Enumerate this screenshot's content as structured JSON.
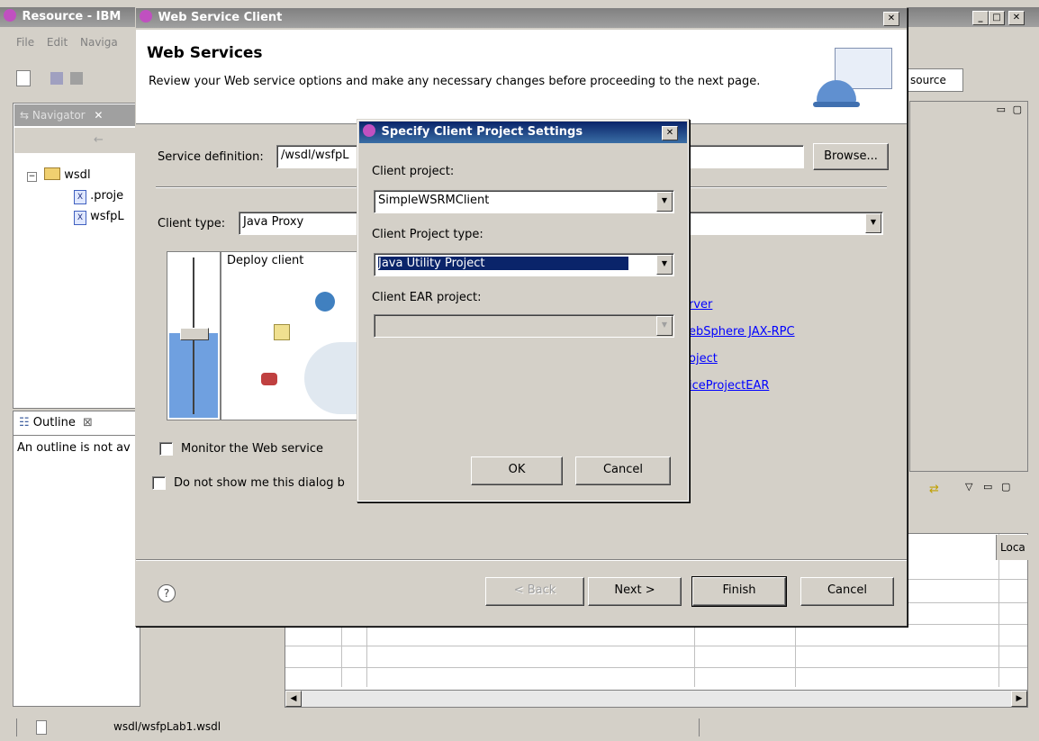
{
  "main_window": {
    "title": "Resource - IBM",
    "menu": [
      "File",
      "Edit",
      "Naviga"
    ],
    "navigator_tab": "Navigator",
    "tree": {
      "root": "wsdl",
      "children": [
        ".proje",
        "wsfpL"
      ]
    },
    "outline_tab": "Outline",
    "outline_text": "An outline is not av",
    "perspective_label": "source",
    "table_header_loc": "Loca",
    "status_file": "wsdl/wsfpLab1.wsdl"
  },
  "wizard": {
    "title": "Web Service Client",
    "heading": "Web Services",
    "description": "Review your Web service options and make any necessary changes before proceeding to the next page.",
    "service_definition_label": "Service definition:",
    "service_definition_value": "/wsdl/wsfpL",
    "browse_label": "Browse...",
    "client_type_label": "Client type:",
    "client_type_value": "Java Proxy",
    "deploy_label": "Deploy client",
    "links": [
      "rver",
      "ebSphere JAX-RPC",
      "oject",
      "iceProjectEAR"
    ],
    "monitor_label": "Monitor the Web service",
    "dont_show_label": "Do not show me this dialog b",
    "help_icon": "?",
    "back_label": "< Back",
    "next_label": "Next >",
    "finish_label": "Finish",
    "cancel_label": "Cancel"
  },
  "dialog": {
    "title": "Specify Client Project Settings",
    "client_project_label": "Client project:",
    "client_project_value": "SimpleWSRMClient",
    "client_project_type_label": "Client Project type:",
    "client_project_type_value": "Java Utility Project",
    "client_ear_label": "Client EAR project:",
    "client_ear_value": "",
    "ok_label": "OK",
    "cancel_label": "Cancel"
  }
}
